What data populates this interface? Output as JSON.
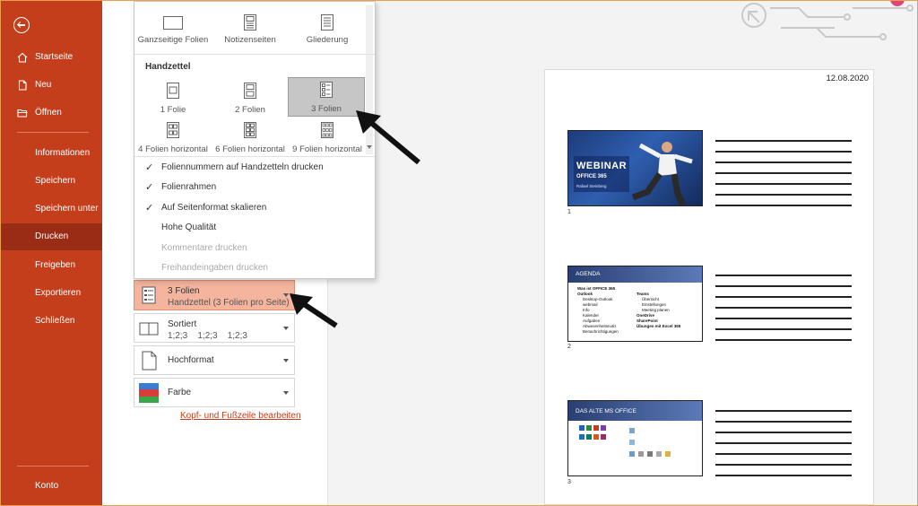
{
  "sidebar": {
    "items": [
      {
        "label": "Startseite",
        "icon": "home-icon"
      },
      {
        "label": "Neu",
        "icon": "new-document-icon"
      },
      {
        "label": "Öffnen",
        "icon": "folder-open-icon"
      },
      {
        "label": "Informationen"
      },
      {
        "label": "Speichern"
      },
      {
        "label": "Speichern unter"
      },
      {
        "label": "Drucken"
      },
      {
        "label": "Freigeben"
      },
      {
        "label": "Exportieren"
      },
      {
        "label": "Schließen"
      }
    ],
    "account": "Konto",
    "active": "Drucken",
    "bg_color": "#c43e1c",
    "active_color": "#9a2b15"
  },
  "dropdown": {
    "layouts": [
      {
        "label": "Ganzseitige Folien"
      },
      {
        "label": "Notizenseiten"
      },
      {
        "label": "Gliederung"
      }
    ],
    "handout_header": "Handzettel",
    "handouts": [
      {
        "label": "1 Folie"
      },
      {
        "label": "2 Folien"
      },
      {
        "label": "3 Folien"
      },
      {
        "label": "4 Folien horizontal"
      },
      {
        "label": "6 Folien horizontal"
      },
      {
        "label": "9 Folien horizontal"
      }
    ],
    "selected": "3 Folien",
    "options": [
      {
        "label": "Foliennummern auf Handzetteln drucken",
        "checked": true,
        "enabled": true
      },
      {
        "label": "Folienrahmen",
        "checked": true,
        "enabled": true
      },
      {
        "label": "Auf Seitenformat skalieren",
        "checked": true,
        "enabled": true
      },
      {
        "label": "Hohe Qualität",
        "checked": false,
        "enabled": true
      },
      {
        "label": "Kommentare drucken",
        "checked": false,
        "enabled": false
      },
      {
        "label": "Freihandeingaben drucken",
        "checked": false,
        "enabled": false
      }
    ]
  },
  "settings": {
    "layout": {
      "label": "3 Folien",
      "sub": "Handzettel (3 Folien pro Seite)"
    },
    "collate": {
      "label": "Sortiert",
      "sub": "1;2;3    1;2;3    1;2;3"
    },
    "orientation": {
      "label": "Hochformat"
    },
    "color": {
      "label": "Farbe"
    },
    "header_footer_link": "Kopf- und Fußzeile bearbeiten",
    "highlight_color": "#f4b49d"
  },
  "preview": {
    "date": "12.08.2020",
    "slides": [
      {
        "number": "1",
        "title": "WEBINAR",
        "subtitle": "OFFICE 365",
        "author": "Rafael Steinberg"
      },
      {
        "number": "2",
        "title": "AGENDA",
        "col1": [
          "Was ist OFFICE 365",
          "Outlook",
          "Desktop-Outlook",
          "webmail",
          "Info",
          "Kalender",
          "Aufgaben",
          "Abwesenheitsnotiz",
          "Benachrichtigungen"
        ],
        "col2": [
          "Teams",
          "Übersicht",
          "Einstellungen",
          "Meeting planen",
          "OneDrive",
          "SharePoint",
          "Übungen mit Excel 365"
        ]
      },
      {
        "number": "3",
        "title": "DAS ALTE MS OFFICE"
      }
    ]
  }
}
